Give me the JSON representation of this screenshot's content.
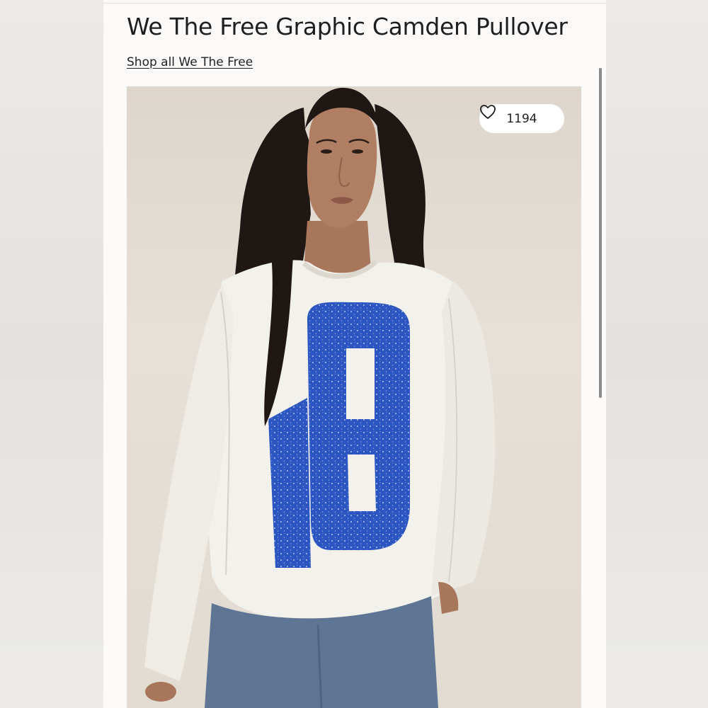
{
  "product": {
    "title": "We The Free Graphic Camden Pullover",
    "brand_link": "Shop all We The Free",
    "likes": "1194",
    "graphic_number": "18"
  },
  "icons": {
    "likes": "heart-outline-icon"
  },
  "colors": {
    "graphic_blue": "#2b55c0",
    "sweater": "#f3f1ec",
    "page_background": "#fbfaf9"
  }
}
